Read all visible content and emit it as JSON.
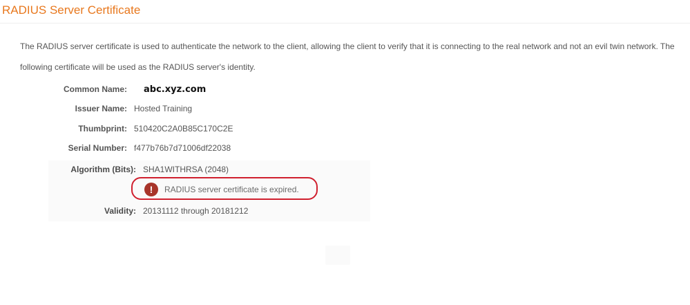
{
  "page": {
    "title": "RADIUS Server Certificate",
    "description": "The RADIUS server certificate is used to authenticate the network to the client, allowing the client to verify that it is connecting to the real network and not an evil twin network. The following certificate will be used as the RADIUS server's identity."
  },
  "certificate": {
    "common_name_label": "Common Name:",
    "common_name_value": "abc.xyz.com",
    "issuer_label": "Issuer Name:",
    "issuer_value": "Hosted Training",
    "thumbprint_label": "Thumbprint:",
    "thumbprint_value": "510420C2A0B85C170C2E",
    "serial_label": "Serial Number:",
    "serial_value": "f477b76b7d71006df22038",
    "algorithm_label": "Algorithm (Bits):",
    "algorithm_value": "SHA1WITHRSA (2048)",
    "validity_label": "Validity:",
    "validity_value": "20131112 through 20181212"
  },
  "alert": {
    "icon": "exclamation-icon",
    "icon_glyph": "!",
    "message": "RADIUS server certificate is expired.",
    "icon_color": "#a8352a",
    "highlight_color": "#d01f2e"
  },
  "colors": {
    "title": "#e8781e",
    "text": "#555555"
  }
}
